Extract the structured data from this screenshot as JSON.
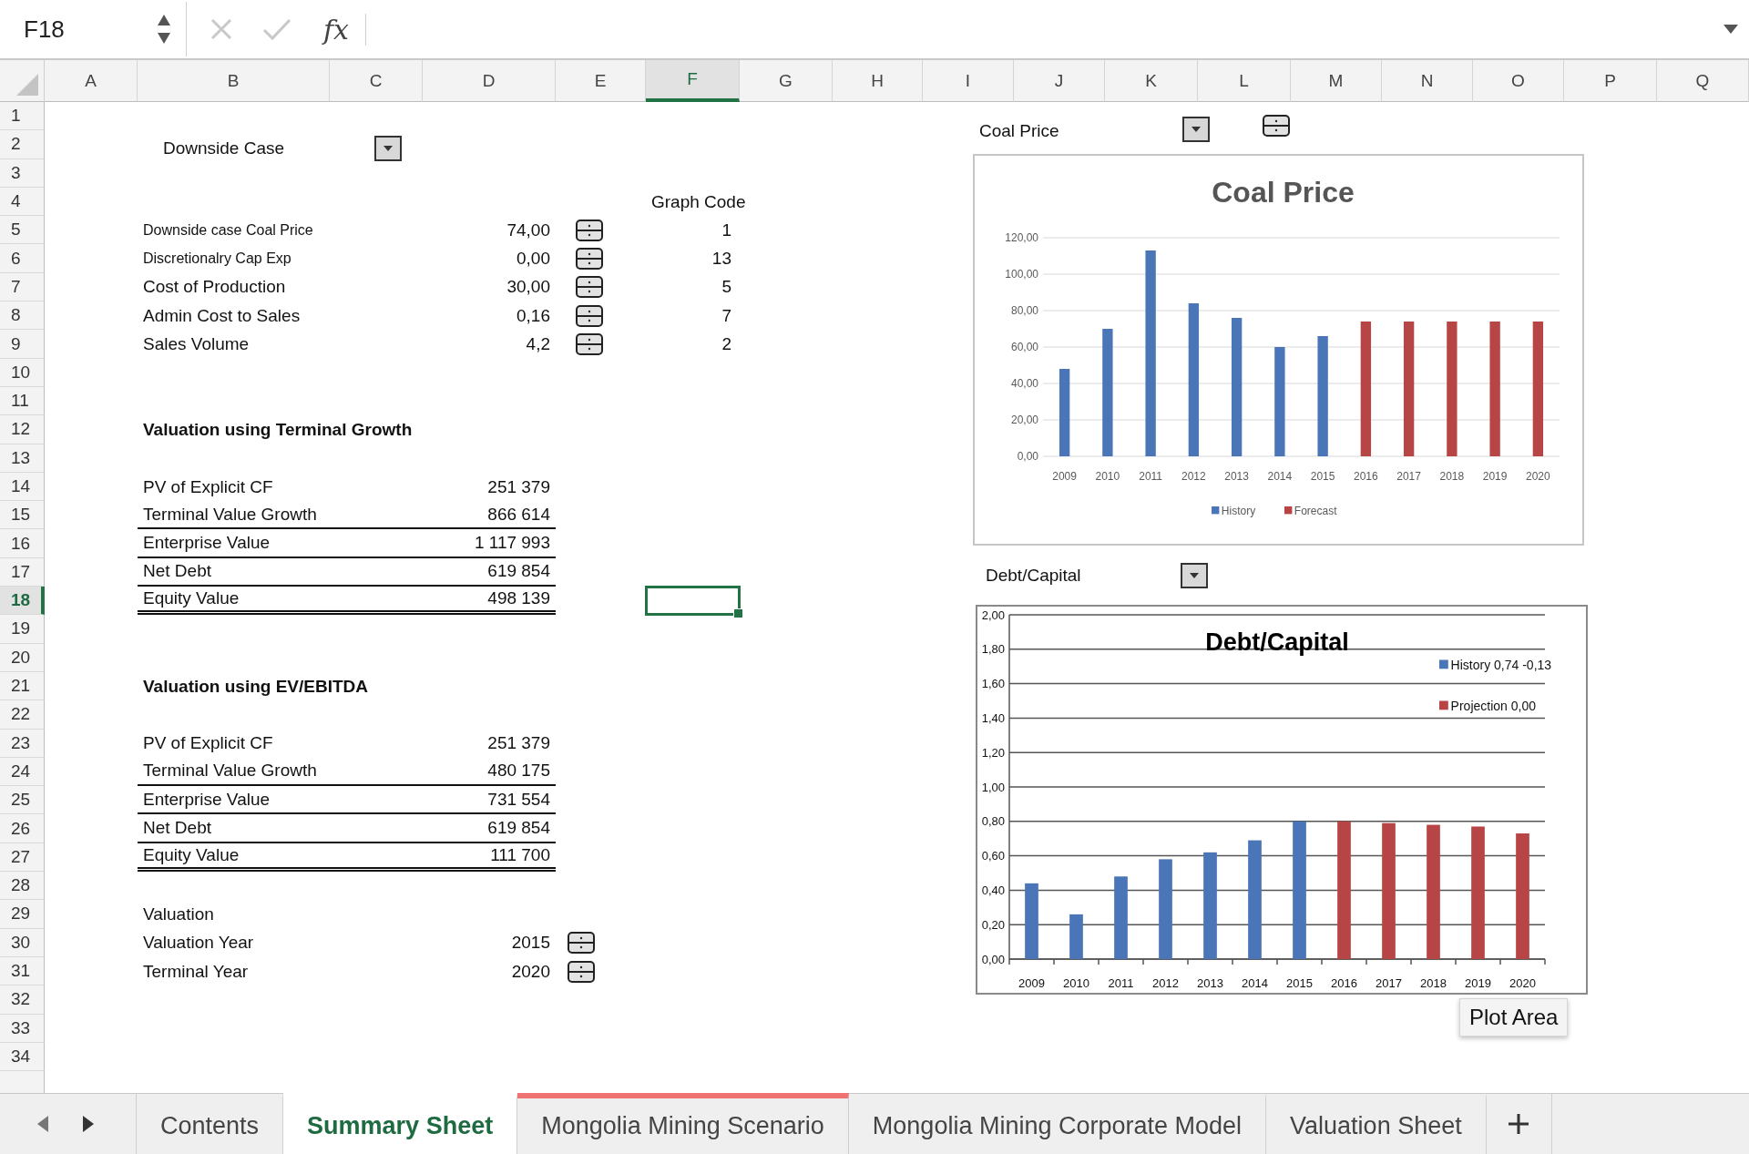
{
  "formula_bar": {
    "name_box": "F18",
    "function_label": "fx"
  },
  "columns": [
    {
      "label": "A",
      "selected": false
    },
    {
      "label": "B",
      "selected": false
    },
    {
      "label": "C",
      "selected": false
    },
    {
      "label": "D",
      "selected": false
    },
    {
      "label": "E",
      "selected": false
    },
    {
      "label": "F",
      "selected": true
    },
    {
      "label": "G",
      "selected": false
    },
    {
      "label": "H",
      "selected": false
    },
    {
      "label": "I",
      "selected": false
    },
    {
      "label": "J",
      "selected": false
    },
    {
      "label": "K",
      "selected": false
    },
    {
      "label": "L",
      "selected": false
    },
    {
      "label": "M",
      "selected": false
    },
    {
      "label": "N",
      "selected": false
    },
    {
      "label": "O",
      "selected": false
    },
    {
      "label": "P",
      "selected": false
    },
    {
      "label": "Q",
      "selected": false
    }
  ],
  "rows": [
    {
      "label": "1",
      "selected": false
    },
    {
      "label": "2",
      "selected": false
    },
    {
      "label": "3",
      "selected": false
    },
    {
      "label": "4",
      "selected": false
    },
    {
      "label": "5",
      "selected": false
    },
    {
      "label": "6",
      "selected": false
    },
    {
      "label": "7",
      "selected": false
    },
    {
      "label": "8",
      "selected": false
    },
    {
      "label": "9",
      "selected": false
    },
    {
      "label": "10",
      "selected": false
    },
    {
      "label": "11",
      "selected": false
    },
    {
      "label": "12",
      "selected": false
    },
    {
      "label": "13",
      "selected": false
    },
    {
      "label": "14",
      "selected": false
    },
    {
      "label": "15",
      "selected": false
    },
    {
      "label": "16",
      "selected": false
    },
    {
      "label": "17",
      "selected": false
    },
    {
      "label": "18",
      "selected": true
    },
    {
      "label": "19",
      "selected": false
    },
    {
      "label": "20",
      "selected": false
    },
    {
      "label": "21",
      "selected": false
    },
    {
      "label": "22",
      "selected": false
    },
    {
      "label": "23",
      "selected": false
    },
    {
      "label": "24",
      "selected": false
    },
    {
      "label": "25",
      "selected": false
    },
    {
      "label": "26",
      "selected": false
    },
    {
      "label": "27",
      "selected": false
    },
    {
      "label": "28",
      "selected": false
    },
    {
      "label": "29",
      "selected": false
    },
    {
      "label": "30",
      "selected": false
    },
    {
      "label": "31",
      "selected": false
    },
    {
      "label": "32",
      "selected": false
    },
    {
      "label": "33",
      "selected": false
    },
    {
      "label": "34",
      "selected": false
    }
  ],
  "scenario": {
    "label": "Downside Case"
  },
  "inputs": {
    "header": "Graph Code",
    "rows": [
      {
        "label": "Downside case Coal Price",
        "value": "74,00",
        "graph_code": "1"
      },
      {
        "label": "Discretionalry Cap Exp",
        "value": "0,00",
        "graph_code": "13"
      },
      {
        "label": "Cost of Production",
        "value": "30,00",
        "graph_code": "5"
      },
      {
        "label": "Admin Cost to Sales",
        "value": "0,16",
        "graph_code": "7"
      },
      {
        "label": "Sales Volume",
        "value": "4,2",
        "graph_code": "2"
      }
    ]
  },
  "sections": [
    {
      "title": "Valuation using Terminal Growth",
      "rows": [
        {
          "label": "PV of Explicit CF",
          "value": "251 379",
          "kind": "plain"
        },
        {
          "label": "Terminal Value Growth",
          "value": "866 614",
          "kind": "underlined"
        },
        {
          "label": "Enterprise Value",
          "value": "1 117 993",
          "kind": "underlined"
        },
        {
          "label": "Net Debt",
          "value": "619 854",
          "kind": "underlined"
        },
        {
          "label": "Equity Value",
          "value": "498 139",
          "kind": "total"
        }
      ]
    },
    {
      "title": "Valuation using EV/EBITDA",
      "rows": [
        {
          "label": "PV of Explicit CF",
          "value": "251 379",
          "kind": "plain"
        },
        {
          "label": "Terminal Value Growth",
          "value": "480 175",
          "kind": "underlined"
        },
        {
          "label": "Enterprise Value",
          "value": "731 554",
          "kind": "underlined"
        },
        {
          "label": "Net Debt",
          "value": "619 854",
          "kind": "underlined"
        },
        {
          "label": "Equity Value",
          "value": "111 700",
          "kind": "total"
        }
      ]
    }
  ],
  "valuation": {
    "title": "Valuation",
    "rows": [
      {
        "label": "Valuation Year",
        "value": "2015"
      },
      {
        "label": "Terminal Year",
        "value": "2020"
      }
    ]
  },
  "charts": [
    {
      "label": "Coal Price",
      "controls": [
        {
          "kind": "dropdown"
        },
        {
          "kind": "spinner"
        }
      ],
      "chart_data": {
        "type": "bar",
        "title": "Coal Price",
        "categories": [
          "2009",
          "2010",
          "2011",
          "2012",
          "2013",
          "2014",
          "2015",
          "2016",
          "2017",
          "2018",
          "2019",
          "2020"
        ],
        "series": [
          {
            "name": "History",
            "color": "#4a76b8",
            "values": [
              48,
              70,
              113,
              84,
              76,
              60,
              66,
              null,
              null,
              null,
              null,
              null
            ]
          },
          {
            "name": "Forecast",
            "color": "#b84545",
            "values": [
              null,
              null,
              null,
              null,
              null,
              null,
              null,
              74,
              74,
              74,
              74,
              74
            ]
          }
        ],
        "grid": true,
        "legend": "bottom",
        "ylim": [
          0,
          120
        ],
        "yticks": [
          {
            "value": 0,
            "label": "0,00"
          },
          {
            "value": 20,
            "label": "20,00"
          },
          {
            "value": 40,
            "label": "40,00"
          },
          {
            "value": 60,
            "label": "60,00"
          },
          {
            "value": 80,
            "label": "80,00"
          },
          {
            "value": 100,
            "label": "100,00"
          },
          {
            "value": 120,
            "label": "120,00"
          }
        ]
      }
    },
    {
      "label": "Debt/Capital",
      "controls": [
        {
          "kind": "dropdown"
        }
      ],
      "chart_data": {
        "type": "bar",
        "title": "Debt/Capital",
        "categories": [
          "2009",
          "2010",
          "2011",
          "2012",
          "2013",
          "2014",
          "2015",
          "2016",
          "2017",
          "2018",
          "2019",
          "2020"
        ],
        "series": [
          {
            "name": "History 0,74 -0,13",
            "color": "#4a76b8",
            "values": [
              0.44,
              0.26,
              0.48,
              0.58,
              0.62,
              0.69,
              0.8,
              null,
              null,
              null,
              null,
              null
            ]
          },
          {
            "name": "Projection 0,00",
            "color": "#b84545",
            "values": [
              null,
              null,
              null,
              null,
              null,
              null,
              null,
              0.8,
              0.79,
              0.78,
              0.77,
              0.73
            ]
          }
        ],
        "grid": true,
        "legend": "right",
        "ylim": [
          0,
          2
        ],
        "yticks": [
          {
            "value": 0,
            "label": "0,00"
          },
          {
            "value": 0.2,
            "label": "0,20"
          },
          {
            "value": 0.4,
            "label": "0,40"
          },
          {
            "value": 0.6,
            "label": "0,60"
          },
          {
            "value": 0.8,
            "label": "0,80"
          },
          {
            "value": 1,
            "label": "1,00"
          },
          {
            "value": 1.2,
            "label": "1,20"
          },
          {
            "value": 1.4,
            "label": "1,40"
          },
          {
            "value": 1.6,
            "label": "1,60"
          },
          {
            "value": 1.8,
            "label": "1,80"
          },
          {
            "value": 2,
            "label": "2,00"
          }
        ]
      }
    }
  ],
  "tooltip": "Plot Area",
  "sheet_tabs": [
    {
      "label": "Contents",
      "selected": false
    },
    {
      "label": "Summary Sheet",
      "selected": true
    },
    {
      "label": "Mongolia Mining Scenario",
      "selected": false,
      "color": "#f07373"
    },
    {
      "label": "Mongolia Mining Corporate Model",
      "selected": false
    },
    {
      "label": "Valuation Sheet",
      "selected": false
    }
  ]
}
